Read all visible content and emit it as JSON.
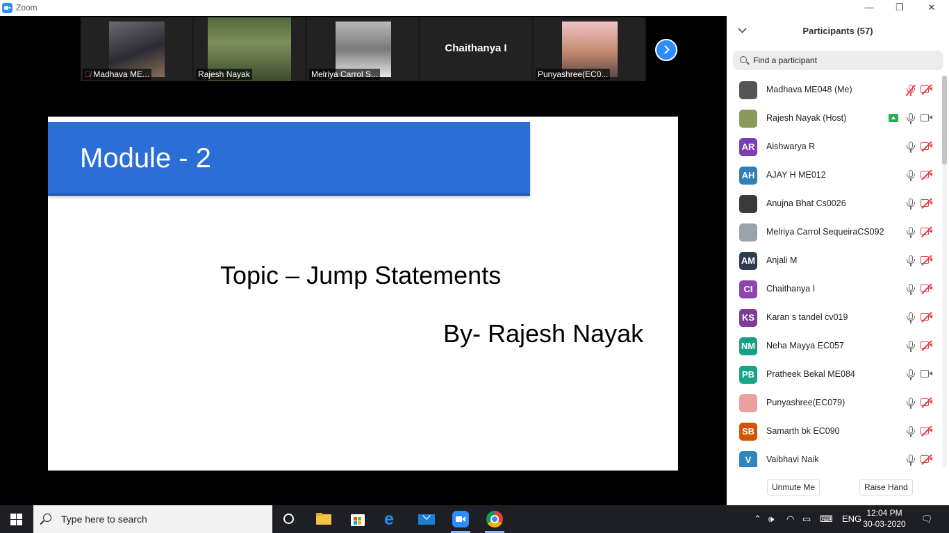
{
  "window": {
    "title": "Zoom",
    "minimize": "—",
    "maximize": "❐",
    "close": "✕"
  },
  "thumbnails": [
    {
      "name": "Madhava ME...",
      "muted": true
    },
    {
      "name": "Rajesh Nayak",
      "muted": false
    },
    {
      "name": "Melriya Carrol S...",
      "muted": false
    },
    {
      "display": "Chaithanya I"
    },
    {
      "name": "Punyashree(EC0...",
      "muted": false
    }
  ],
  "slide": {
    "heading": "Module - 2",
    "topic": "Topic – Jump Statements",
    "byline": "By- Rajesh Nayak"
  },
  "panel": {
    "title": "Participants (57)",
    "search_placeholder": "Find a participant",
    "participants": [
      {
        "name": "Madhava ME048 (Me)",
        "initials": "",
        "color": "#555555",
        "mic": "muted",
        "cam": "off"
      },
      {
        "name": "Rajesh Nayak (Host)",
        "initials": "",
        "color": "#8a9a5b",
        "mic": "on",
        "cam": "on",
        "sharing": true
      },
      {
        "name": "Aishwarya R",
        "initials": "AR",
        "color": "#7b3fb3",
        "mic": "on",
        "cam": "off"
      },
      {
        "name": "AJAY H ME012",
        "initials": "AH",
        "color": "#2f7fb8",
        "mic": "on",
        "cam": "off"
      },
      {
        "name": "Anujna Bhat Cs0026",
        "initials": "",
        "color": "#3a3a3a",
        "mic": "on",
        "cam": "off"
      },
      {
        "name": "Melriya Carrol SequeiraCS092",
        "initials": "",
        "color": "#9aa3a8",
        "mic": "on",
        "cam": "off"
      },
      {
        "name": "Anjali M",
        "initials": "AM",
        "color": "#2e3b4e",
        "mic": "on",
        "cam": "off"
      },
      {
        "name": "Chaithanya I",
        "initials": "CI",
        "color": "#8e44ad",
        "mic": "on",
        "cam": "off"
      },
      {
        "name": "Karan s tandel cv019",
        "initials": "KS",
        "color": "#7d3c98",
        "mic": "on",
        "cam": "off"
      },
      {
        "name": "Neha Mayya EC057",
        "initials": "NM",
        "color": "#16a085",
        "mic": "on",
        "cam": "off"
      },
      {
        "name": "Pratheek Bekal ME084",
        "initials": "PB",
        "color": "#17a589",
        "mic": "on",
        "cam": "on"
      },
      {
        "name": "Punyashree(EC079)",
        "initials": "",
        "color": "#e8a0a0",
        "mic": "on",
        "cam": "off"
      },
      {
        "name": "Samarth bk EC090",
        "initials": "SB",
        "color": "#d35400",
        "mic": "on",
        "cam": "off"
      },
      {
        "name": "Vaibhavi Naik",
        "initials": "V",
        "color": "#2e86c1",
        "mic": "on",
        "cam": "off"
      }
    ],
    "unmute_label": "Unmute Me",
    "raise_hand_label": "Raise Hand"
  },
  "taskbar": {
    "search_placeholder": "Type here to search",
    "language": "ENG",
    "time": "12:04 PM",
    "date": "30-03-2020",
    "pinned": [
      "task-view-icon",
      "file-explorer-icon",
      "store-icon",
      "edge-icon",
      "mail-icon",
      "zoom-icon",
      "chrome-icon"
    ]
  }
}
